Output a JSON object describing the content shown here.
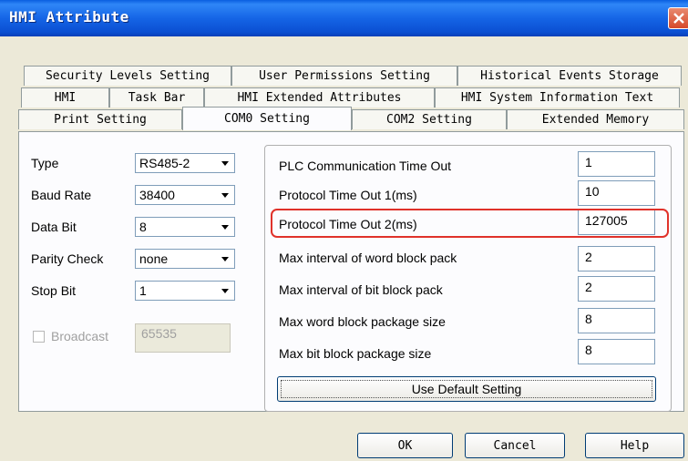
{
  "window": {
    "title": "HMI Attribute"
  },
  "tabs": {
    "row1": [
      "Security Levels Setting",
      "User Permissions Setting",
      "Historical Events Storage"
    ],
    "row2": [
      "HMI",
      "Task Bar",
      "HMI Extended Attributes",
      "HMI System Information Text"
    ],
    "row3": [
      "Print Setting",
      "COM0 Setting",
      "COM2 Setting",
      "Extended Memory"
    ],
    "active": "COM0 Setting"
  },
  "com": {
    "type": {
      "label": "Type",
      "value": "RS485-2"
    },
    "baud_rate": {
      "label": "Baud Rate",
      "value": "38400"
    },
    "data_bit": {
      "label": "Data Bit",
      "value": "8"
    },
    "parity_check": {
      "label": "Parity Check",
      "value": "none"
    },
    "stop_bit": {
      "label": "Stop Bit",
      "value": "1"
    },
    "broadcast": {
      "label": "Broadcast",
      "value": "65535",
      "checked": false,
      "enabled": false
    }
  },
  "timeouts": [
    {
      "label": "PLC Communication Time Out",
      "value": "1"
    },
    {
      "label": "Protocol Time Out 1(ms)",
      "value": "10"
    },
    {
      "label": "Protocol Time Out 2(ms)",
      "value": "127005"
    },
    {
      "label": "Max interval of word block pack",
      "value": "2"
    },
    {
      "label": "Max interval of bit block pack",
      "value": "2"
    },
    {
      "label": "Max word block package size",
      "value": "8"
    },
    {
      "label": "Max bit block package size",
      "value": "8"
    }
  ],
  "buttons": {
    "use_default": "Use Default Setting",
    "ok": "OK",
    "cancel": "Cancel",
    "help": "Help"
  },
  "colors": {
    "titlebar": "#0a5fe0",
    "highlight": "#e0322a",
    "dialog_bg": "#ece9d8"
  }
}
